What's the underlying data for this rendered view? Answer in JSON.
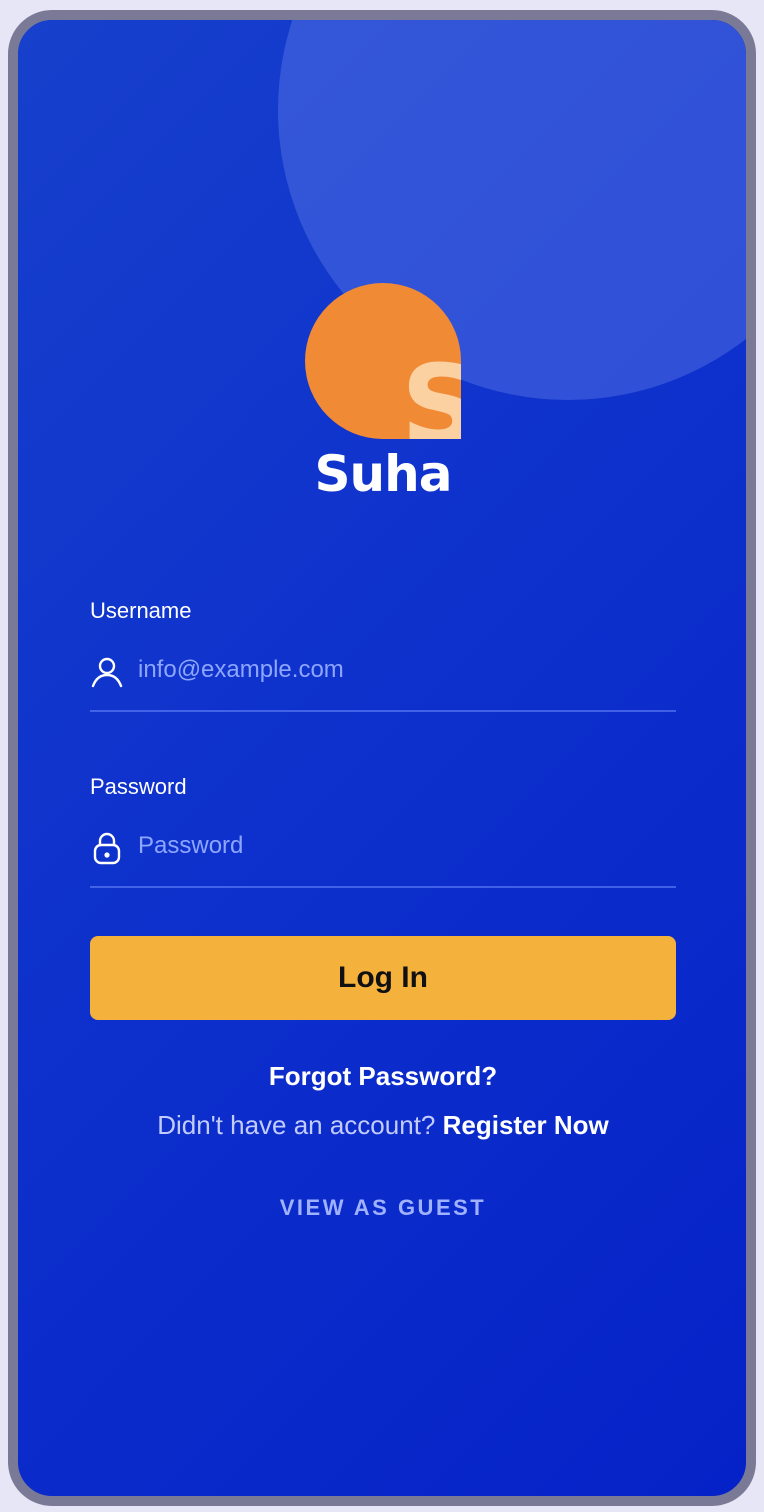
{
  "brand": {
    "name": "Suha",
    "mark_letter": "S",
    "colors": {
      "mark": "#f08a35",
      "mark_letter": "#fbd1a2",
      "background": "#0b2bc9",
      "button": "#f4b13c"
    }
  },
  "form": {
    "username": {
      "label": "Username",
      "placeholder": "info@example.com",
      "value": "",
      "icon": "user-icon"
    },
    "password": {
      "label": "Password",
      "placeholder": "Password",
      "value": "",
      "icon": "lock-icon"
    },
    "submit_label": "Log In"
  },
  "links": {
    "forgot": "Forgot Password?",
    "register_prompt": "Didn't have an account?",
    "register": "Register Now",
    "guest": "VIEW AS GUEST"
  }
}
